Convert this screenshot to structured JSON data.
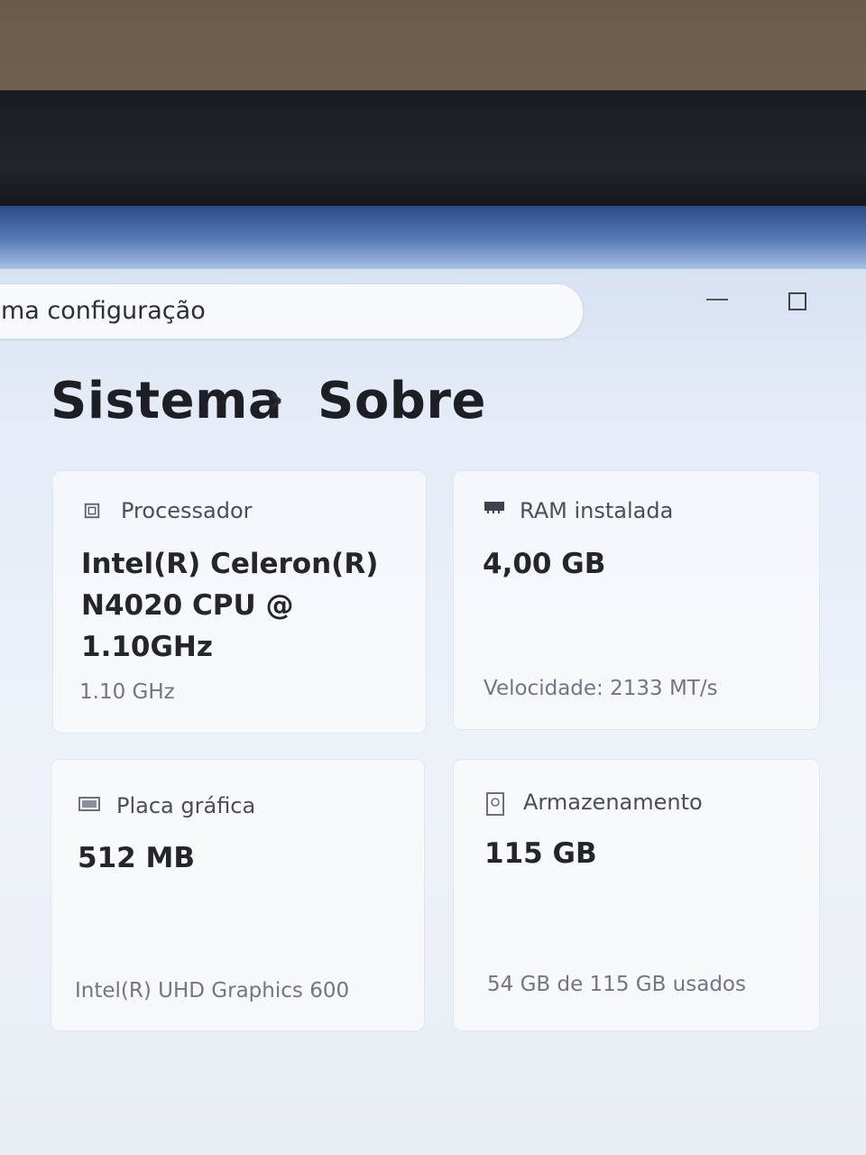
{
  "window": {
    "search_placeholder": "ma configuração"
  },
  "breadcrumb": {
    "parent": "Sistema",
    "separator": "›",
    "current": "Sobre"
  },
  "cards": {
    "processor": {
      "label": "Processador",
      "value_line1": "Intel(R) Celeron(R)",
      "value_line2": "N4020 CPU @ 1.10GHz",
      "sub": "1.10 GHz",
      "icon": "processor-icon"
    },
    "ram": {
      "label": "RAM instalada",
      "value": "4,00 GB",
      "sub": "Velocidade: 2133 MT/s",
      "icon": "memory-icon"
    },
    "graphics": {
      "label": "Placa gráfica",
      "value": "512 MB",
      "sub": "Intel(R) UHD Graphics 600",
      "icon": "display-icon"
    },
    "storage": {
      "label": "Armazenamento",
      "value": "115 GB",
      "sub": "54 GB de 115 GB usados",
      "icon": "storage-icon"
    }
  }
}
